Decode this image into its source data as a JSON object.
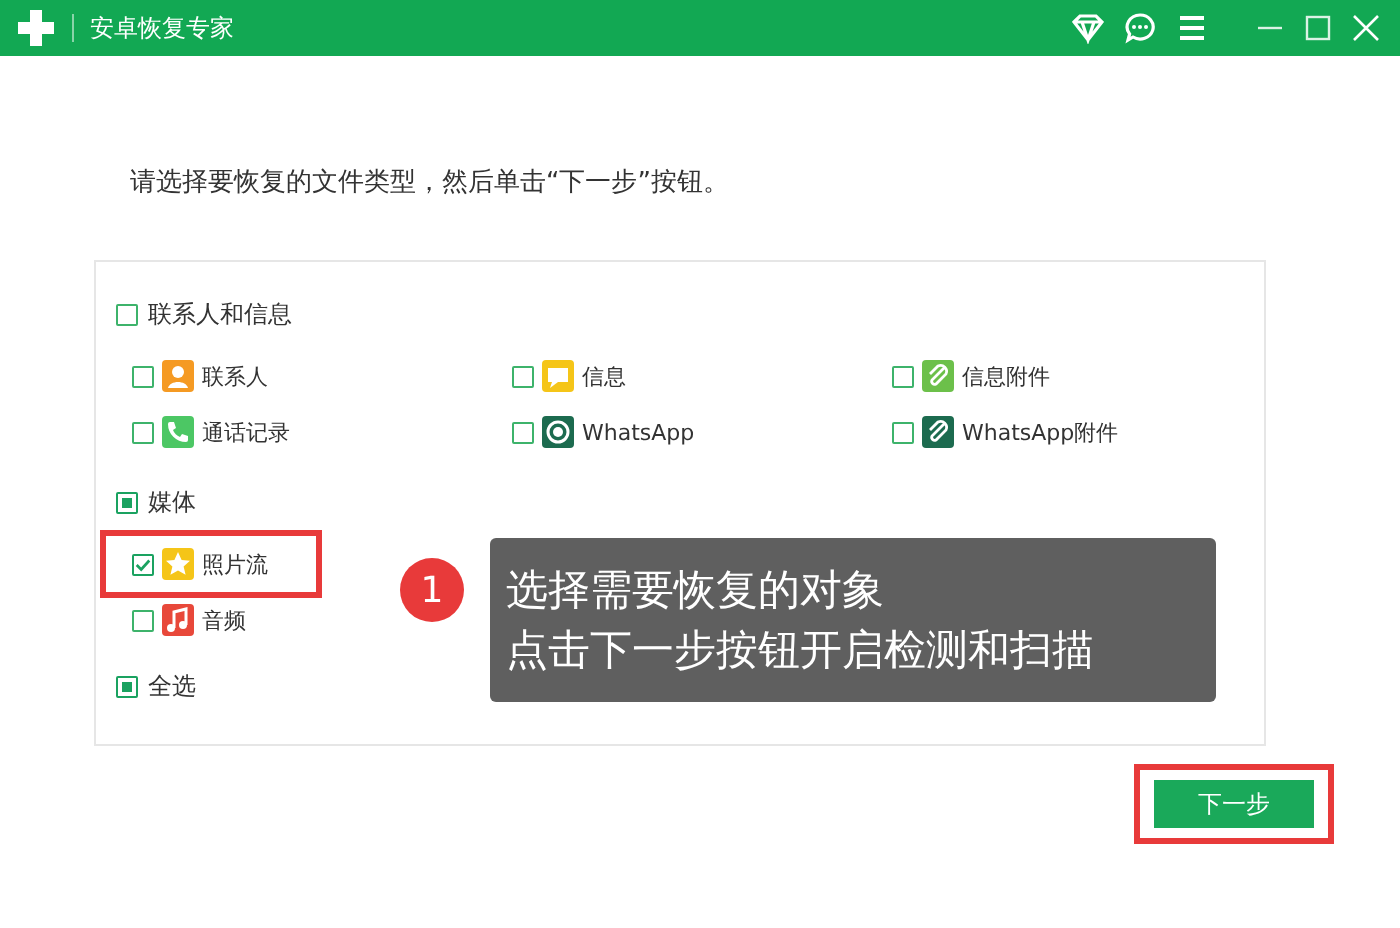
{
  "window": {
    "title": "安卓恢复专家"
  },
  "instruction": "请选择要恢复的文件类型，然后单击“下一步”按钮。",
  "groups": [
    {
      "label": "联系人和信息",
      "checked": false,
      "partial": false,
      "rows": [
        [
          {
            "label": "联系人",
            "kind": "contact",
            "color": "#f59a23",
            "checked": false,
            "highlighted": false
          },
          {
            "label": "信息",
            "kind": "message",
            "color": "#f5c518",
            "checked": false,
            "highlighted": false
          },
          {
            "label": "信息附件",
            "kind": "attachment",
            "color": "#6cc04a",
            "checked": false,
            "highlighted": false
          }
        ],
        [
          {
            "label": "通话记录",
            "kind": "call",
            "color": "#4cc764",
            "checked": false,
            "highlighted": false
          },
          {
            "label": "WhatsApp",
            "kind": "whatsapp",
            "color": "#1c6b4f",
            "checked": false,
            "highlighted": false
          },
          {
            "label": "WhatsApp附件",
            "kind": "attachment",
            "color": "#1c6b4f",
            "checked": false,
            "highlighted": false
          }
        ]
      ]
    },
    {
      "label": "媒体",
      "checked": true,
      "partial": true,
      "rows": [
        [
          {
            "label": "照片流",
            "kind": "photo",
            "color": "#f5c518",
            "checked": true,
            "highlighted": true
          }
        ],
        [
          {
            "label": "音频",
            "kind": "audio",
            "color": "#e8483a",
            "checked": false,
            "highlighted": false
          }
        ]
      ]
    }
  ],
  "select_all": {
    "label": "全选",
    "checked": true,
    "partial": true
  },
  "tooltip": {
    "step": "1",
    "lines": [
      "选择需要恢复的对象",
      "点击下一步按钮开启检测和扫描"
    ]
  },
  "next_button": {
    "label": "下一步",
    "highlighted": true
  }
}
